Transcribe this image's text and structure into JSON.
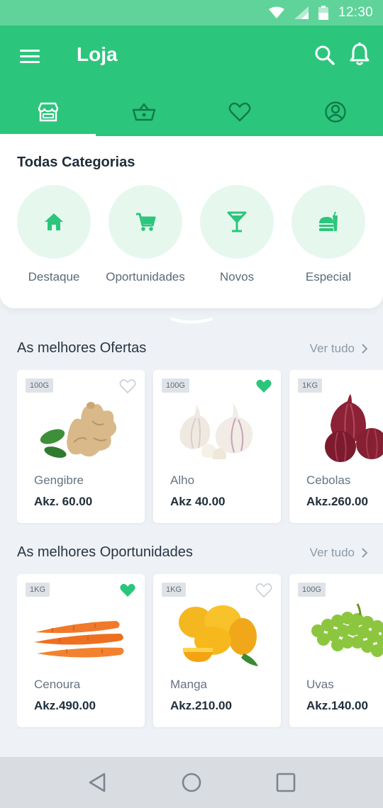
{
  "status_bar": {
    "time": "12:30"
  },
  "app_bar": {
    "title": "Loja"
  },
  "tabs": [
    {
      "icon": "store-icon",
      "active": true
    },
    {
      "icon": "basket-icon",
      "active": false
    },
    {
      "icon": "heart-icon",
      "active": false
    },
    {
      "icon": "account-icon",
      "active": false
    }
  ],
  "categories": {
    "title": "Todas Categorias",
    "items": [
      {
        "label": "Destaque",
        "icon": "home-icon"
      },
      {
        "label": "Oportunidades",
        "icon": "cart-icon"
      },
      {
        "label": "Novos",
        "icon": "cocktail-icon"
      },
      {
        "label": "Especial",
        "icon": "fastfood-icon"
      }
    ]
  },
  "offers": {
    "title": "As melhores Ofertas",
    "see_all": "Ver tudo",
    "products": [
      {
        "name": "Gengibre",
        "price": "Akz. 60.00",
        "weight": "100G",
        "favorite": false,
        "image": "ginger"
      },
      {
        "name": "Alho",
        "price": "Akz 40.00",
        "weight": "100G",
        "favorite": true,
        "image": "garlic"
      },
      {
        "name": "Cebolas",
        "price": "Akz.260.00",
        "weight": "1KG",
        "favorite": false,
        "image": "onion"
      }
    ]
  },
  "opportunities": {
    "title": "As melhores Oportunidades",
    "see_all": "Ver tudo",
    "products": [
      {
        "name": "Cenoura",
        "price": "Akz.490.00",
        "weight": "1KG",
        "favorite": true,
        "image": "carrot"
      },
      {
        "name": "Manga",
        "price": "Akz.210.00",
        "weight": "1KG",
        "favorite": false,
        "image": "mango"
      },
      {
        "name": "Uvas",
        "price": "Akz.140.00",
        "weight": "100G",
        "favorite": false,
        "image": "grapes"
      }
    ]
  },
  "colors": {
    "primary": "#2cc57c",
    "status_bar": "#5fd39a",
    "category_bg": "#e6f8ee"
  },
  "nav_bar": [
    "back-icon",
    "home-circle-icon",
    "recents-icon"
  ]
}
